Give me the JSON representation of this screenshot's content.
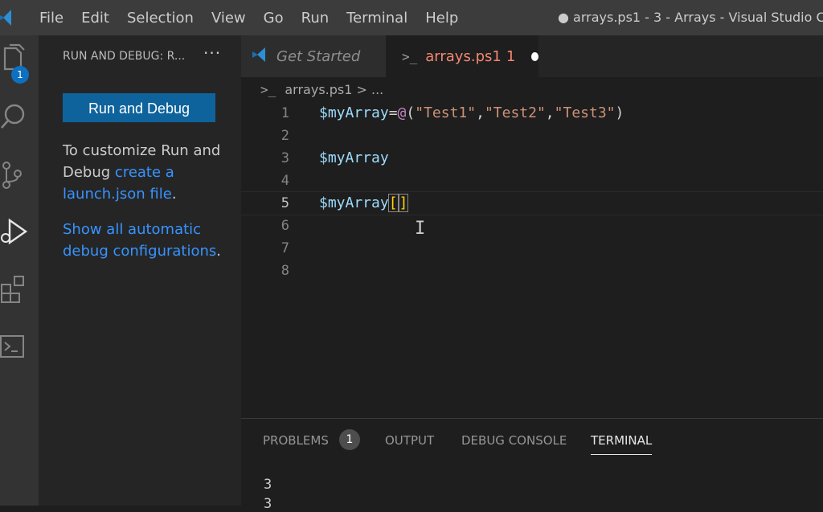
{
  "titlebar": {
    "menu": [
      "File",
      "Edit",
      "Selection",
      "View",
      "Go",
      "Run",
      "Terminal",
      "Help"
    ],
    "window_title": "● arrays.ps1 - 3 - Arrays - Visual Studio C"
  },
  "activitybar": {
    "explorer_badge": "1",
    "icons": [
      "files-icon",
      "search-icon",
      "source-control-icon",
      "run-debug-icon",
      "extensions-icon",
      "terminal-icon"
    ]
  },
  "sidebar": {
    "header": "RUN AND DEBUG: R...",
    "more": "···",
    "run_button": "Run and Debug",
    "customize_text": "To customize Run and Debug ",
    "customize_link": "create a launch.json file",
    "customize_end": ".",
    "show_link": "Show all automatic debug configurations",
    "show_end": "."
  },
  "tabs": {
    "get_started": "Get Started",
    "file_name": "arrays.ps1",
    "file_problems": "1"
  },
  "breadcrumb": {
    "file": "arrays.ps1",
    "rest": "> ..."
  },
  "editor": {
    "line_numbers": [
      "1",
      "2",
      "3",
      "4",
      "5",
      "6",
      "7",
      "8"
    ],
    "line1": {
      "var": "$myArray",
      "op": "=",
      "at": "@",
      "open": "(",
      "s1": "\"Test1\"",
      "c1": ",",
      "s2": "\"Test2\"",
      "c2": ",",
      "s3": "\"Test3\"",
      "close": ")"
    },
    "line3": "$myArray",
    "line5": {
      "var": "$myArray",
      "bracket_open": "[",
      "bracket_close": "]"
    }
  },
  "panel": {
    "problems": "PROBLEMS",
    "problems_count": "1",
    "output": "OUTPUT",
    "debug_console": "DEBUG CONSOLE",
    "terminal": "TERMINAL",
    "terminal_lines": [
      "3",
      "3"
    ]
  },
  "colors": {
    "accent": "#0e639c",
    "link": "#3794ff",
    "modified_tab": "#f48771"
  }
}
